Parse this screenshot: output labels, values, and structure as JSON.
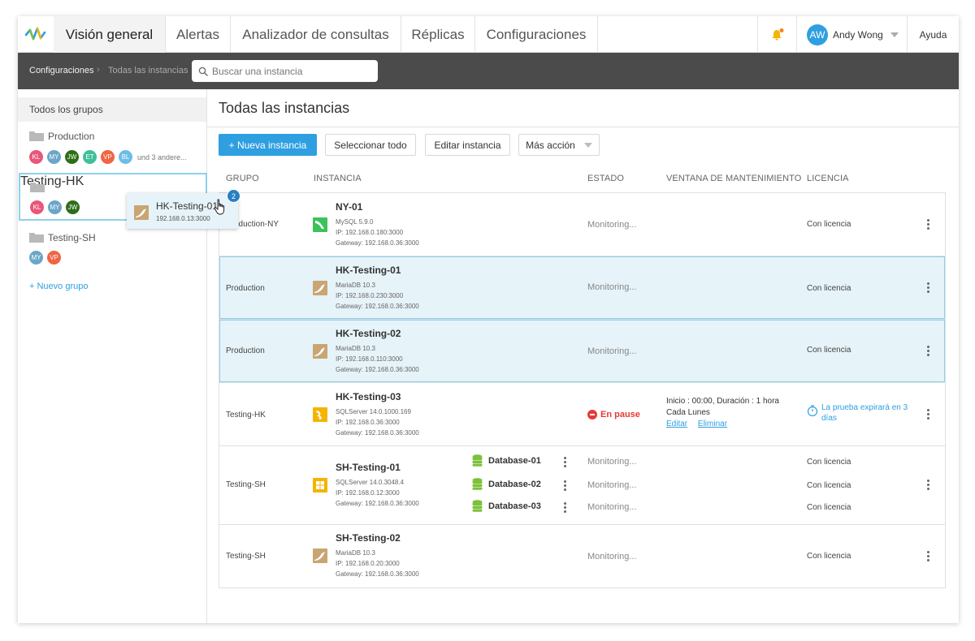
{
  "nav": {
    "tabs": [
      {
        "label": "Visión general",
        "active": true
      },
      {
        "label": "Alertas"
      },
      {
        "label": "Analizador de consultas"
      },
      {
        "label": "Réplicas"
      },
      {
        "label": "Configuraciones"
      }
    ],
    "user": {
      "initials": "AW",
      "name": "Andy Wong"
    },
    "help": "Ayuda"
  },
  "breadcrumb": {
    "root": "Configuraciones",
    "sep": "›",
    "current": "Todas las instancias",
    "search_placeholder": "Buscar una instancia"
  },
  "sidebar": {
    "all_groups": "Todos los grupos",
    "groups": [
      {
        "name": "Production",
        "members": [
          "KL",
          "MY",
          "JW",
          "ET",
          "VP",
          "BL"
        ],
        "more": "und 3 andere..."
      },
      {
        "name": "Testing-HK",
        "members": [
          "KL",
          "MY",
          "JW"
        ]
      },
      {
        "name": "Testing-SH",
        "members": [
          "MY",
          "VP"
        ]
      }
    ],
    "new_group": "+ Nuevo grupo"
  },
  "drag": {
    "title": "HK-Testing-01",
    "address": "192.168.0.13:3000",
    "count": "2"
  },
  "main": {
    "title": "Todas las instancias",
    "buttons": {
      "new": "+ Nueva instancia",
      "select_all": "Seleccionar todo",
      "edit": "Editar instancia",
      "more": "Más acción"
    },
    "headers": {
      "group": "GRUPO",
      "instance": "INSTANCIA",
      "state": "ESTADO",
      "window": "VENTANA DE MANTENIMIENTO",
      "license": "LICENCIA"
    }
  },
  "rows": [
    {
      "group": "Production-NY",
      "name": "NY-01",
      "engine": "MySQL 5.9.0",
      "ip": "IP: 192.168.0.180:3000",
      "gateway": "Gateway: 192.168.0.36:3000",
      "state": "Monitoring...",
      "license": "Con licencia"
    },
    {
      "group": "Production",
      "name": "HK-Testing-01",
      "engine": "MariaDB 10.3",
      "ip": "IP: 192.168.0.230:3000",
      "gateway": "Gateway: 192.168.0.36:3000",
      "state": "Monitoring...",
      "license": "Con licencia"
    },
    {
      "group": "Production",
      "name": "HK-Testing-02",
      "engine": "MariaDB 10.3",
      "ip": "IP: 192.168.0.110:3000",
      "gateway": "Gateway: 192.168.0.36:3000",
      "state": "Monitoring...",
      "license": "Con licencia"
    },
    {
      "group": "Testing-HK",
      "name": "HK-Testing-03",
      "engine": "SQLServer 14.0.1000.169",
      "ip": "IP: 192.168.0.36:3000",
      "gateway": "Gateway: 192.168.0.36:3000",
      "state": "En pause",
      "window_line1": "Inicio : 00:00, Duración : 1 hora",
      "window_line2": "Cada Lunes",
      "window_edit": "Editar",
      "window_delete": "Eliminar",
      "license": "La prueba expirará en 3 días"
    },
    {
      "group": "Testing-SH",
      "name": "SH-Testing-01",
      "engine": "SQLServer 14.0.3048.4",
      "ip": "IP: 192.168.0.12:3000",
      "gateway": "Gateway: 192.168.0.36:3000",
      "databases": [
        {
          "name": "Database-01",
          "state": "Monitoring...",
          "license": "Con licencia"
        },
        {
          "name": "Database-02",
          "state": "Monitoring...",
          "license": "Con licencia"
        },
        {
          "name": "Database-03",
          "state": "Monitoring...",
          "license": "Con licencia"
        }
      ]
    },
    {
      "group": "Testing-SH",
      "name": "SH-Testing-02",
      "engine": "MariaDB 10.3",
      "ip": "IP: 192.168.0.20:3000",
      "gateway": "Gateway: 192.168.0.36:3000",
      "state": "Monitoring...",
      "license": "Con licencia"
    }
  ],
  "colors": {
    "accent": "#2e9fe0",
    "dark_bar": "#4b4b4b",
    "selected": "#e6f3f8",
    "pause": "#e53935",
    "db_green": "#7cc13a"
  }
}
